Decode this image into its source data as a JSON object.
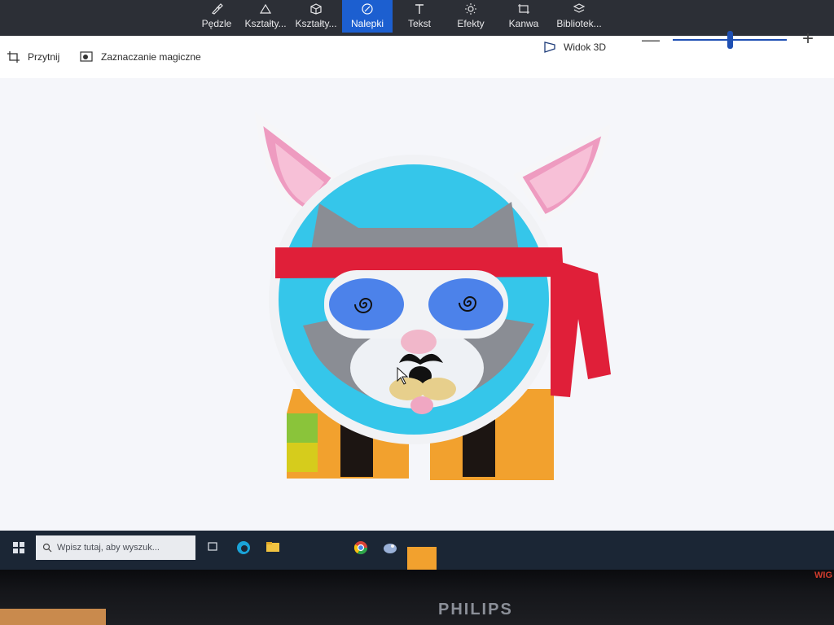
{
  "ribbon": {
    "tabs": [
      {
        "label": "Pędzle",
        "icon": "brush-icon"
      },
      {
        "label": "Kształty...",
        "icon": "shapes-2d-icon"
      },
      {
        "label": "Kształty...",
        "icon": "cube-icon"
      },
      {
        "label": "Nalepki",
        "icon": "sticker-icon",
        "active": true
      },
      {
        "label": "Tekst",
        "icon": "text-icon"
      },
      {
        "label": "Efekty",
        "icon": "sun-icon"
      },
      {
        "label": "Kanwa",
        "icon": "canvas-icon"
      },
      {
        "label": "Bibliotek...",
        "icon": "library-icon"
      }
    ],
    "accent": "#1c5fd0"
  },
  "toolbar": {
    "crop_label": "Przytnij",
    "magic_select_label": "Zaznaczanie magiczne",
    "view3d_label": "Widok 3D",
    "zoom_minus": "—",
    "zoom_plus": "+",
    "zoom_level": 0.5
  },
  "taskbar": {
    "search_placeholder": "Wpisz tutaj, aby wyszuk...",
    "tray_text": "WIG"
  },
  "monitor": {
    "brand": "PHILIPS"
  }
}
